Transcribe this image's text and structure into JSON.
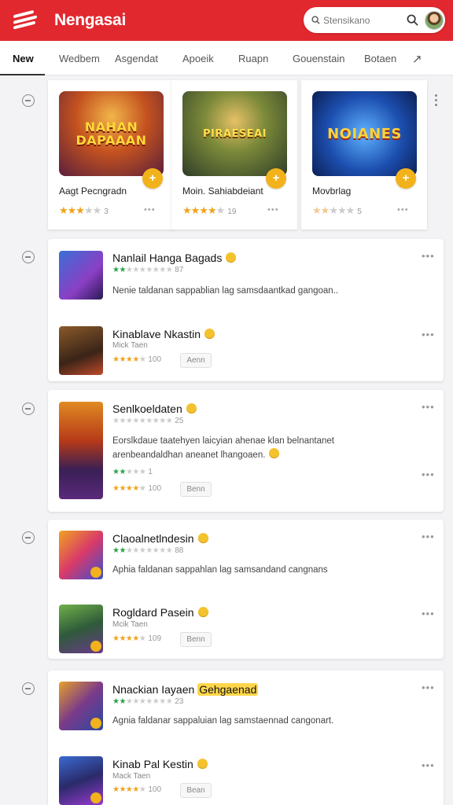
{
  "header": {
    "title": "Nengasai",
    "search_placeholder": "Stensikano"
  },
  "tabs": [
    {
      "label": "New",
      "active": true
    },
    {
      "label": "Wedbem"
    },
    {
      "label": "Asgendat"
    },
    {
      "label": "Apoeik"
    },
    {
      "label": "Ruapn"
    },
    {
      "label": "Gouenstain"
    },
    {
      "label": "Botaen"
    }
  ],
  "featured": [
    {
      "name": "Aagt Pecngradn",
      "art_text": "NAHAN DAPAAAN",
      "rating": 3,
      "count": "3"
    },
    {
      "name": "Moin. Sahiabdeiant",
      "art_text": "PIRAESEAI",
      "rating": 4,
      "count": "19"
    },
    {
      "name": "Movbrlag",
      "art_text": "NOIANES",
      "rating": 2,
      "count": "5"
    }
  ],
  "sections": [
    {
      "rows": [
        {
          "title": "Nanlail Hanga Bagads",
          "stars": "2",
          "count": "87",
          "desc": "Nenie taldanan sappablian lag samsdaantkad gangoan.."
        },
        {
          "title": "Kinablave Nkastin",
          "sub": "Mick Taen",
          "stars": "4",
          "count": "100",
          "chip": "Aenn"
        }
      ]
    },
    {
      "rows": [
        {
          "title": "Senlkoeldaten",
          "stars": "0",
          "count": "25",
          "desc1": "Eorslkdaue taatehyen laicyian ahenae klan belnantanet",
          "desc2": "arenbeandaldhan aneanet lhangoaen."
        },
        {
          "count": "1",
          "count2": "100",
          "chip": "Benn"
        }
      ]
    },
    {
      "rows": [
        {
          "title": "Claoalnetlndesin",
          "stars": "2",
          "count": "88",
          "desc": "Aphia faldanan sappahlan lag samsandand cangnans"
        },
        {
          "title": "Rogldard Pasein",
          "sub": "Mcik Taen",
          "stars": "4",
          "count": "109",
          "chip": "Benn"
        }
      ]
    },
    {
      "rows": [
        {
          "title": "Nnackian Iayaen",
          "tag": "Gehgaenad",
          "stars": "2",
          "count": "23",
          "desc": "Agnia faldanar sappaluian lag samstaennad cangonart."
        },
        {
          "title": "Kinab Pal Kestin",
          "sub": "Mack Taen",
          "stars": "4",
          "count": "100",
          "chip": "Bean"
        }
      ]
    }
  ],
  "colors": {
    "brand": "#e0282e",
    "accent": "#f2b21c",
    "star": "#f0a31c",
    "green": "#2aa34a"
  }
}
